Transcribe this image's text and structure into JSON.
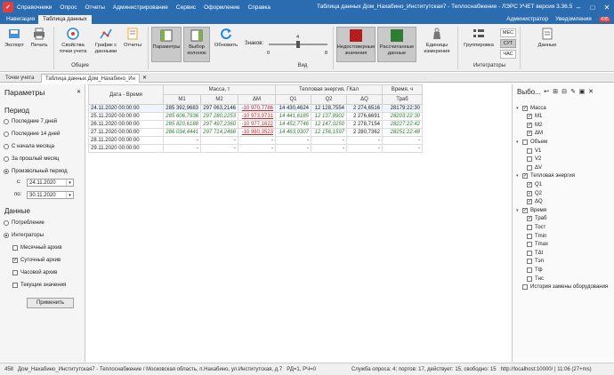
{
  "titlebar": {
    "menu": [
      "Справочники",
      "Опрос",
      "Отчеты",
      "Администрирование",
      "Сервис",
      "Оформление",
      "Справка"
    ],
    "title": "Таблица данных Дом_Нахабино_Институтская7 - Теплоснабжение - ЛЭРС УЧЕТ версия 3.36.5"
  },
  "ribbon_tabs": [
    "Навигация",
    "Таблица данных"
  ],
  "user": {
    "name": "Администратор",
    "notifications_label": "Уведомления",
    "count": "435"
  },
  "ribbon": {
    "buttons": {
      "export": "Экспорт",
      "print": "Печать",
      "props": "Свойства точки учета",
      "graph": "График с данными",
      "reports": "Отчеты",
      "params": "Параметры",
      "columns": "Выбор колонок",
      "refresh": "Обновить",
      "signs_label": "Знаков:",
      "scale_min": "0",
      "scale_val": "4",
      "scale_max": "8",
      "insufficient": "Недостоверные значения",
      "calculated": "Рассчитанные данные",
      "units": "Единицы измерения",
      "grouping": "Группировка",
      "mes": "МЕС",
      "sut": "СУТ",
      "chas": "ЧАС",
      "data": "Данные"
    },
    "groups": {
      "common": "Общие",
      "view": "Вид",
      "integrators": "Интеграторы"
    },
    "colors": {
      "insufficient": "#b71c1c",
      "calculated": "#2e7d32"
    }
  },
  "doc_tabs": [
    "Точки учета",
    "Таблица данных Дом_Нахабино_Ин"
  ],
  "left": {
    "title": "Параметры",
    "period_head": "Период",
    "periods": [
      "Последние 7 дней",
      "Последние 14 дней",
      "С начала месяца",
      "За прошлый месяц",
      "Произвольный период"
    ],
    "from_label": "с:",
    "from_value": "24.11.2020",
    "to_label": "по:",
    "to_value": "30.11.2020",
    "data_head": "Данные",
    "data_opts": [
      "Потребление",
      "Интеграторы"
    ],
    "archives": [
      "Месячный архив",
      "Суточный архив",
      "Часовой архив",
      "Текущие значения"
    ],
    "apply": "Применить"
  },
  "table": {
    "date_head": "Дата - Время",
    "groups": [
      "Масса, т",
      "Тепловая энергия, ГКал",
      "Время, ч"
    ],
    "cols": [
      "M1",
      "M2",
      "ΔM",
      "Q1",
      "Q2",
      "ΔQ",
      "Траб"
    ],
    "rows": [
      [
        "24.11.2020 00:00:00",
        "285 392,9683",
        "297 063,2146",
        "-10 970,7786",
        "14 430,4624",
        "12 128,7554",
        "2 274,6516",
        "28179:22:30"
      ],
      [
        "25.11.2020 00:00:00",
        "285 606,7936",
        "297 280,2253",
        "-10 973,9731",
        "14 441,6185",
        "12 137,8902",
        "2 276,6691",
        "28203:22:30"
      ],
      [
        "26.11.2020 00:00:00",
        "285 820,6188",
        "297 497,2360",
        "-10 977,1622",
        "14 452,7746",
        "12 147,0250",
        "2 278,7154",
        "28227:22:42"
      ],
      [
        "27.11.2020 00:00:00",
        "286 034,4441",
        "297 714,2468",
        "-10 980,3523",
        "14 463,9307",
        "12 156,1597",
        "2 280,7362",
        "28251:22:48"
      ],
      [
        "28.11.2020 00:00:00",
        "-",
        "-",
        "-",
        "-",
        "-",
        "-",
        "-"
      ],
      [
        "29.11.2020 00:00:00",
        "-",
        "-",
        "-",
        "-",
        "-",
        "-",
        "-"
      ]
    ]
  },
  "right": {
    "title": "Выбо...",
    "tree": [
      {
        "label": "Масса",
        "level": 0,
        "checked": true,
        "expander": "▾"
      },
      {
        "label": "M1",
        "level": 1,
        "checked": true,
        "expander": ""
      },
      {
        "label": "M2",
        "level": 1,
        "checked": true,
        "expander": ""
      },
      {
        "label": "ΔM",
        "level": 1,
        "checked": true,
        "expander": ""
      },
      {
        "label": "Объем",
        "level": 0,
        "checked": false,
        "expander": "▾"
      },
      {
        "label": "V1",
        "level": 1,
        "checked": false,
        "expander": ""
      },
      {
        "label": "V2",
        "level": 1,
        "checked": false,
        "expander": ""
      },
      {
        "label": "ΔV",
        "level": 1,
        "checked": false,
        "expander": ""
      },
      {
        "label": "Тепловая энергия",
        "level": 0,
        "checked": true,
        "expander": "▾"
      },
      {
        "label": "Q1",
        "level": 1,
        "checked": true,
        "expander": ""
      },
      {
        "label": "Q2",
        "level": 1,
        "checked": true,
        "expander": ""
      },
      {
        "label": "ΔQ",
        "level": 1,
        "checked": true,
        "expander": ""
      },
      {
        "label": "Время",
        "level": 0,
        "checked": true,
        "expander": "▾"
      },
      {
        "label": "Траб",
        "level": 1,
        "checked": true,
        "expander": ""
      },
      {
        "label": "Тост",
        "level": 1,
        "checked": false,
        "expander": ""
      },
      {
        "label": "Tmin",
        "level": 1,
        "checked": false,
        "expander": ""
      },
      {
        "label": "Tmax",
        "level": 1,
        "checked": false,
        "expander": ""
      },
      {
        "label": "TΔt",
        "level": 1,
        "checked": false,
        "expander": ""
      },
      {
        "label": "Tэп",
        "level": 1,
        "checked": false,
        "expander": ""
      },
      {
        "label": "Tф",
        "level": 1,
        "checked": false,
        "expander": ""
      },
      {
        "label": "Tнс",
        "level": 1,
        "checked": false,
        "expander": ""
      },
      {
        "label": "История замены оборудования",
        "level": 0,
        "checked": false,
        "expander": ""
      }
    ]
  },
  "status": {
    "num": "458",
    "address": "Дом_Нахабино_Институтская7 - Теплоснабжение / Московская область, п.Нахабино, ул.Институтская, д.7",
    "rd": "РД=1, РЧ=0",
    "service": "Служба опроса: 4; портов: 17, действует: 15, свободно: 15",
    "server": "http://localhost:10000/ | 11:06 (27+ms)"
  }
}
